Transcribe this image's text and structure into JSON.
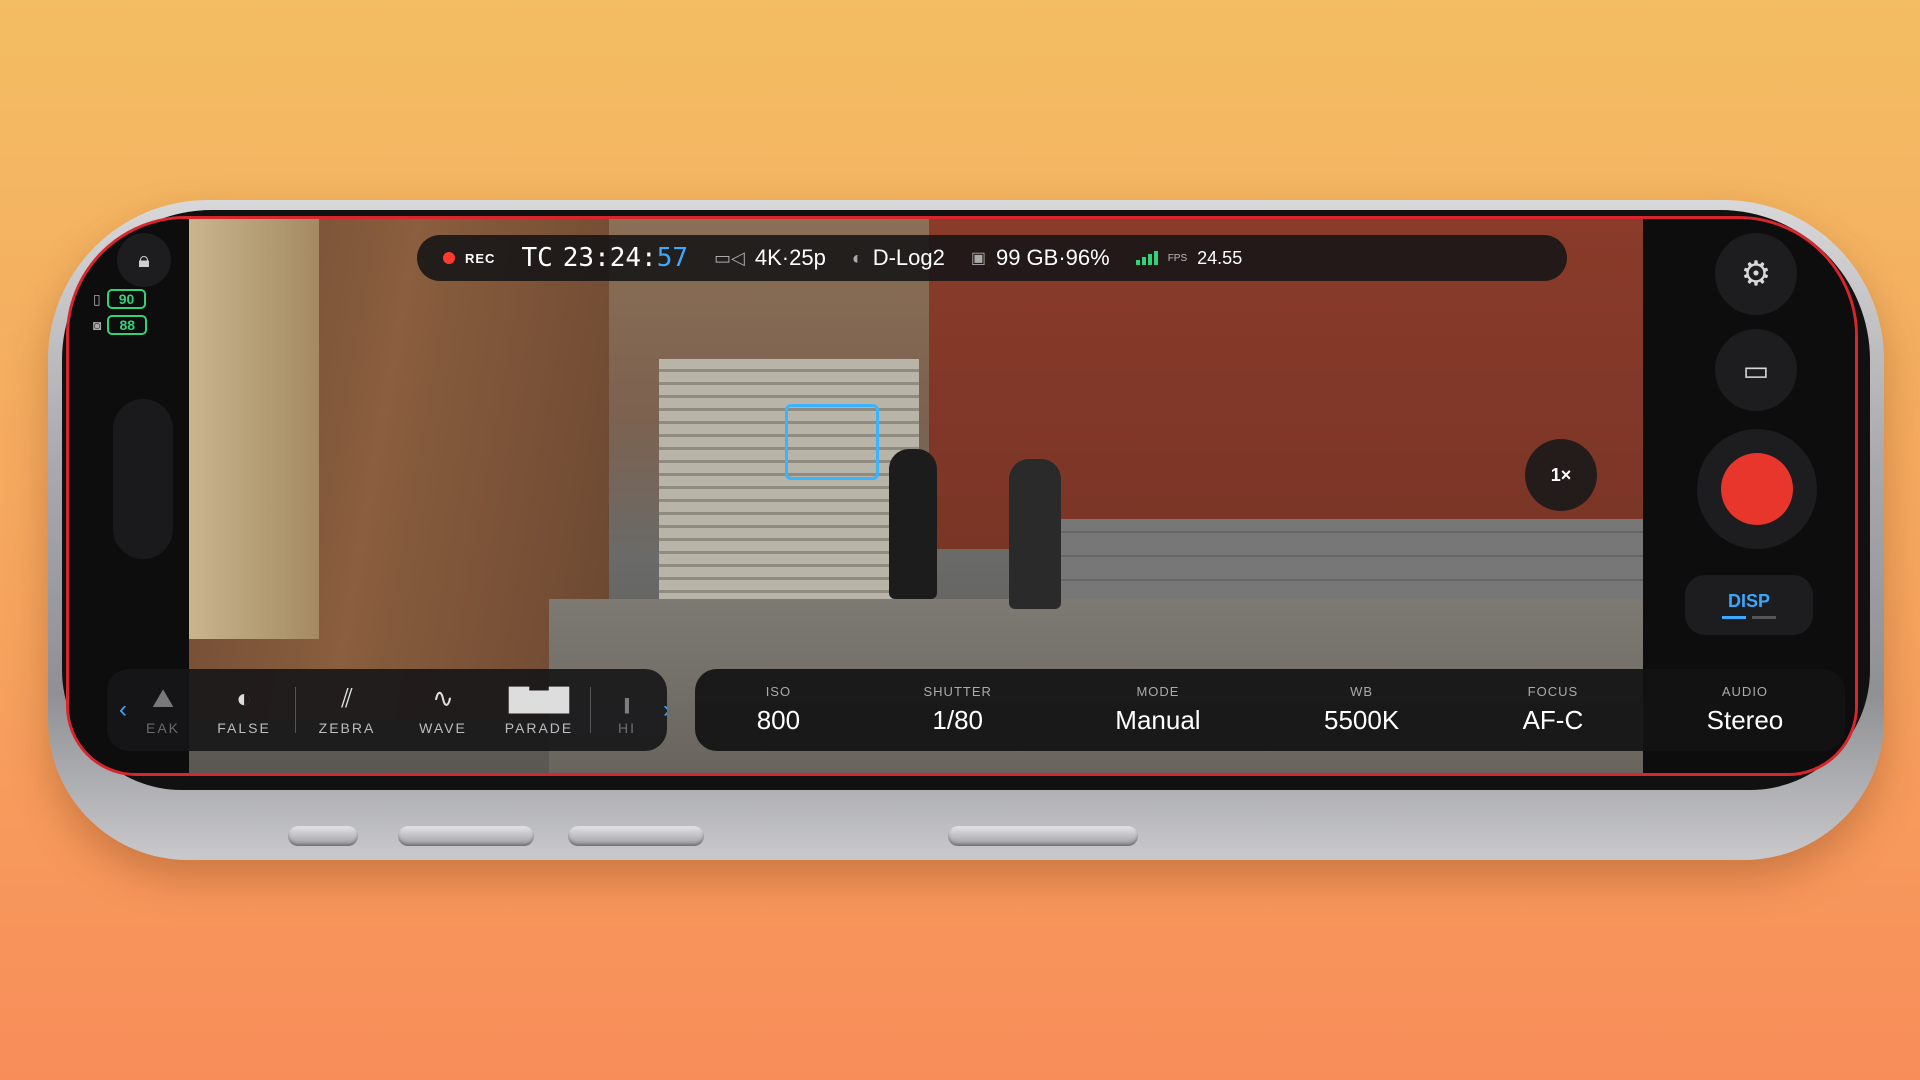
{
  "top_bar": {
    "rec_label": "REC",
    "tc_label": "TC",
    "timecode_main": "23:24:",
    "timecode_frames": "57",
    "resolution": "4K·25p",
    "profile": "D-Log2",
    "storage": "99 GB·96%",
    "fps_label": "FPS",
    "fps_value": "24.55"
  },
  "status": {
    "battery_phone": "90",
    "battery_camera": "88"
  },
  "right_controls": {
    "zoom": "1×",
    "disp_label": "DISP"
  },
  "tools": [
    {
      "label": "EAK",
      "icon": "peak-icon"
    },
    {
      "label": "FALSE",
      "icon": "false-color-icon"
    },
    {
      "label": "ZEBRA",
      "icon": "zebra-icon"
    },
    {
      "label": "WAVE",
      "icon": "waveform-icon"
    },
    {
      "label": "PARADE",
      "icon": "parade-icon"
    },
    {
      "label": "HI",
      "icon": "histogram-icon"
    }
  ],
  "params": [
    {
      "key": "ISO",
      "value": "800"
    },
    {
      "key": "SHUTTER",
      "value": "1/80"
    },
    {
      "key": "MODE",
      "value": "Manual"
    },
    {
      "key": "WB",
      "value": "5500K"
    },
    {
      "key": "FOCUS",
      "value": "AF-C"
    },
    {
      "key": "AUDIO",
      "value": "Stereo"
    }
  ],
  "colors": {
    "accent": "#3aa8ff",
    "record": "#e8362c",
    "battery": "#33d17a"
  }
}
